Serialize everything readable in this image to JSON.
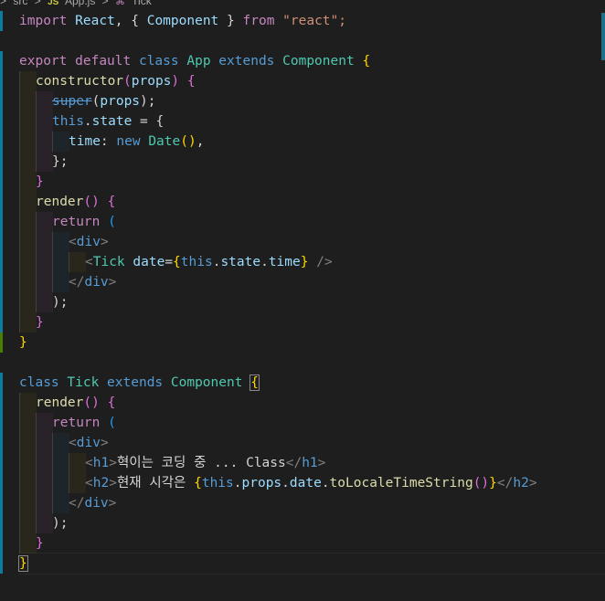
{
  "breadcrumb": {
    "items": [
      "src",
      "App.js",
      "Tick"
    ],
    "separator": ">"
  },
  "code": {
    "l1": [
      "import",
      "React",
      ", {",
      "Component",
      "}",
      "from",
      "\"react\";"
    ],
    "l3": [
      "export",
      "default",
      "class",
      "App",
      "extends",
      "Component",
      "{"
    ],
    "l4": [
      "constructor",
      "(",
      "props",
      ")",
      "{"
    ],
    "l5": [
      "super",
      "(",
      "props",
      ");"
    ],
    "l6": [
      "this",
      ".",
      "state",
      " = {"
    ],
    "l7": [
      "time",
      ": ",
      "new",
      "Date",
      "()",
      ","
    ],
    "l8": [
      "};"
    ],
    "l9": [
      "}"
    ],
    "l10": [
      "render",
      "()",
      "{"
    ],
    "l11": [
      "return",
      "("
    ],
    "l12": [
      "<",
      "div",
      ">"
    ],
    "l13": [
      "<",
      "Tick",
      "date",
      "=",
      "{",
      "this",
      ".",
      "state",
      ".",
      "time",
      "}",
      "/>"
    ],
    "l14": [
      "</",
      "div",
      ">"
    ],
    "l15": [
      ");"
    ],
    "l16": [
      "}"
    ],
    "l17": [
      "}"
    ],
    "l19": [
      "class",
      "Tick",
      "extends",
      "Component",
      "{"
    ],
    "l20": [
      "render",
      "()",
      "{"
    ],
    "l21": [
      "return",
      "("
    ],
    "l22": [
      "<",
      "div",
      ">"
    ],
    "l23": [
      "<",
      "h1",
      ">",
      "혁이는 코딩 중 ... Class",
      "</",
      "h1",
      ">"
    ],
    "l24": [
      "<",
      "h2",
      ">",
      "현재 시각은 ",
      "{",
      "this",
      ".",
      "props",
      ".",
      "date",
      ".",
      "toLocaleTimeString",
      "()",
      "}",
      "</",
      "h2",
      ">"
    ],
    "l25": [
      "</",
      "div",
      ">"
    ],
    "l26": [
      ");"
    ],
    "l27": [
      "}"
    ],
    "l28": [
      "}"
    ]
  }
}
